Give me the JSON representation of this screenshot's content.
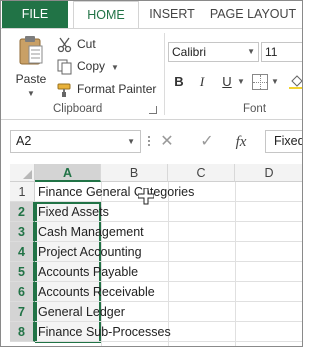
{
  "ribbon_tabs": {
    "file": "FILE",
    "home": "HOME",
    "insert": "INSERT",
    "page_layout": "PAGE LAYOUT"
  },
  "clipboard_group": {
    "paste_label": "Paste",
    "cut_label": "Cut",
    "copy_label": "Copy",
    "format_painter_label": "Format Painter",
    "group_label": "Clipboard"
  },
  "font_group": {
    "font_name": "Calibri",
    "font_size": "11",
    "bold": "B",
    "italic": "I",
    "underline": "U",
    "group_label": "Font"
  },
  "formula_bar": {
    "name_box": "A2",
    "cancel": "✕",
    "enter": "✓",
    "fx": "fx",
    "content": "Fixed Assets"
  },
  "grid": {
    "columns": [
      "A",
      "B",
      "C",
      "D"
    ],
    "rows": [
      {
        "num": "1",
        "value": "Finance General Categories"
      },
      {
        "num": "2",
        "value": "Fixed Assets"
      },
      {
        "num": "3",
        "value": "Cash Management"
      },
      {
        "num": "4",
        "value": "Project Accounting"
      },
      {
        "num": "5",
        "value": "Accounts Payable"
      },
      {
        "num": "6",
        "value": "Accounts Receivable"
      },
      {
        "num": "7",
        "value": "General Ledger"
      },
      {
        "num": "8",
        "value": "Finance Sub-Processes"
      }
    ]
  },
  "colors": {
    "accent": "#217346",
    "header_bg": "#f3f3f3",
    "selected_header_bg": "#d4d4d4"
  },
  "icons": [
    "clipboard-icon",
    "scissors-icon",
    "copy-icon",
    "format-painter-icon",
    "borders-icon",
    "fill-color-icon",
    "cursor-icon"
  ]
}
